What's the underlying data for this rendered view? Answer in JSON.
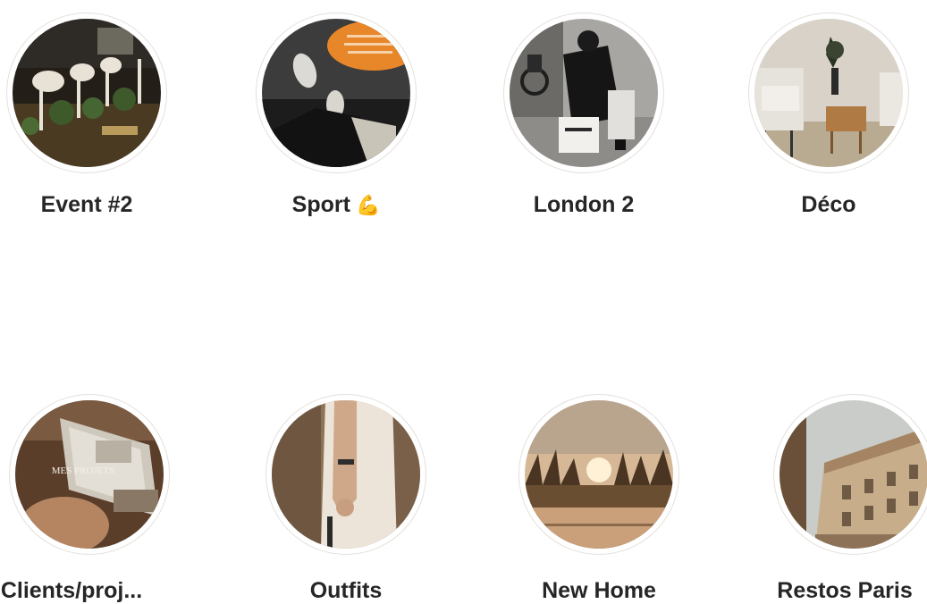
{
  "highlights": [
    {
      "title": "Event #2"
    },
    {
      "title": "Sport",
      "emoji": "💪"
    },
    {
      "title": "London 2"
    },
    {
      "title": "Déco"
    },
    {
      "title": "Clients/proj...",
      "cover_text": "MES PROJETS"
    },
    {
      "title": "Outfits"
    },
    {
      "title": "New Home"
    },
    {
      "title": "Restos Paris"
    }
  ]
}
